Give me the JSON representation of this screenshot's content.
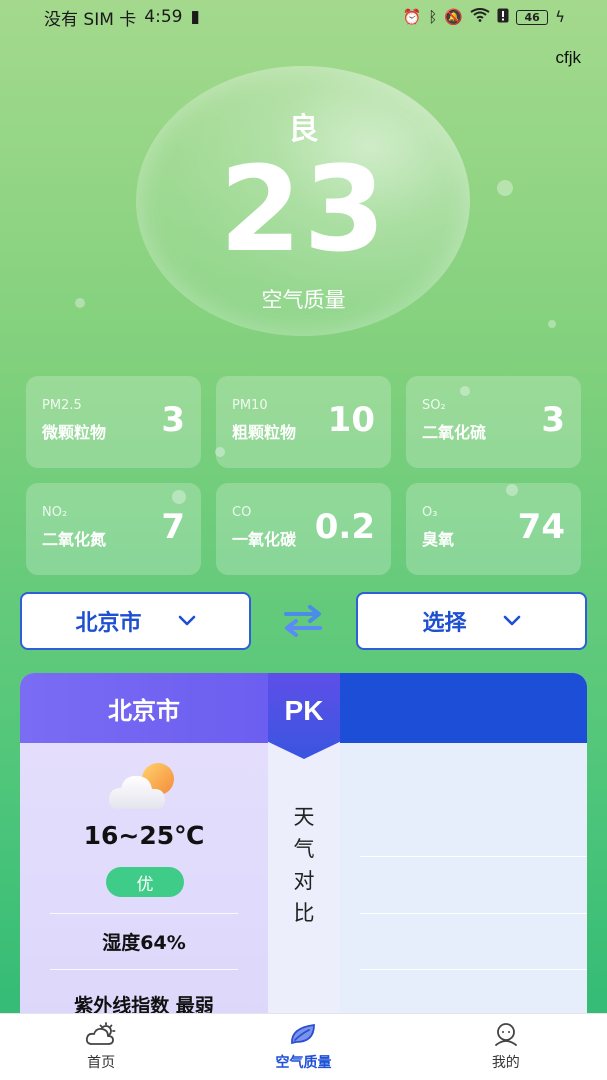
{
  "status_bar": {
    "carrier": "没有 SIM 卡",
    "time": "4:59",
    "battery": "46"
  },
  "app_tag": "cfjk",
  "air_quality": {
    "level": "良",
    "value": "23",
    "label": "空气质量"
  },
  "pollutants": [
    {
      "code": "PM2.5",
      "name": "微颗粒物",
      "value": "3"
    },
    {
      "code": "PM10",
      "name": "粗颗粒物",
      "value": "10"
    },
    {
      "code": "SO₂",
      "name": "二氧化硫",
      "value": "3"
    },
    {
      "code": "NO₂",
      "name": "二氧化氮",
      "value": "7"
    },
    {
      "code": "CO",
      "name": "一氧化碳",
      "value": "0.2"
    },
    {
      "code": "O₃",
      "name": "臭氧",
      "value": "74"
    }
  ],
  "compare": {
    "city_left": "北京市",
    "city_right": "选择",
    "pk": "PK",
    "left_panel": {
      "city": "北京市",
      "temp": "16~25℃",
      "aq_badge": "优",
      "humidity": "湿度64%",
      "uv": "紫外线指数 最弱"
    },
    "compare_label": [
      "天",
      "气",
      "对",
      "比"
    ]
  },
  "tabs": [
    {
      "label": "首页",
      "active": false
    },
    {
      "label": "空气质量",
      "active": true
    },
    {
      "label": "我的",
      "active": false
    }
  ],
  "colors": {
    "accent": "#1e50d8",
    "good_badge": "#3fcc88",
    "pk_purple": "#6c5ef0"
  }
}
